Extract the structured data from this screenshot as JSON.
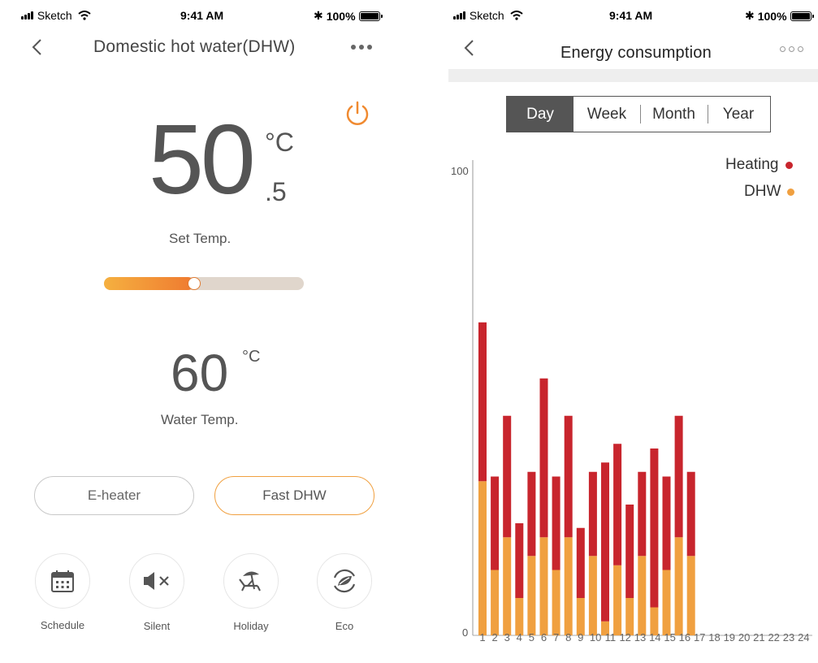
{
  "left_screen": {
    "status_bar": {
      "carrier": "Sketch",
      "time": "9:41 AM",
      "battery": "100%"
    },
    "nav": {
      "title": "Domestic hot water(DHW)"
    },
    "set_temp": {
      "integer": "50",
      "unit": "°C",
      "decimal": ".5",
      "label": "Set Temp."
    },
    "slider": {
      "level_fraction": 0.45,
      "gradient_start": "#f5b040",
      "gradient_end": "#ef7a30",
      "track_color": "#e0d6cc"
    },
    "water_temp": {
      "value": "60",
      "unit": "°C",
      "label": "Water Temp."
    },
    "buttons": {
      "eheater": "E-heater",
      "fast_dhw": "Fast DHW"
    },
    "modes": [
      {
        "label": "Schedule",
        "icon": "calendar-icon"
      },
      {
        "label": "Silent",
        "icon": "mute-speaker-icon"
      },
      {
        "label": "Holiday",
        "icon": "beach-chair-icon"
      },
      {
        "label": "Eco",
        "icon": "eco-leaf-icon"
      }
    ],
    "accent_color": "#f08a30"
  },
  "right_screen": {
    "status_bar": {
      "carrier": "Sketch",
      "time": "9:41 AM",
      "battery": "100%"
    },
    "nav": {
      "title": "Energy consumption"
    },
    "tabs": [
      "Day",
      "Week",
      "Month",
      "Year"
    ],
    "selected_tab": "Day",
    "chart_data": {
      "type": "bar",
      "stacked": true,
      "ylim": [
        0,
        100
      ],
      "ytick_labels": [
        "100",
        "0"
      ],
      "categories": [
        "1",
        "2",
        "3",
        "4",
        "5",
        "6",
        "7",
        "8",
        "9",
        "10",
        "11",
        "12",
        "13",
        "14",
        "15",
        "16",
        "17",
        "18",
        "19",
        "20",
        "21",
        "22",
        "23",
        "24"
      ],
      "series": [
        {
          "name": "DHW",
          "color": "#f0a040",
          "values": [
            33,
            14,
            21,
            8,
            17,
            21,
            14,
            21,
            8,
            17,
            3,
            15,
            8,
            17,
            6,
            14,
            21,
            17,
            0,
            0,
            0,
            0,
            0,
            0,
            0
          ]
        },
        {
          "name": "Heating",
          "color": "#c8252d",
          "values": [
            34,
            20,
            26,
            16,
            18,
            34,
            20,
            26,
            15,
            18,
            34,
            26,
            20,
            18,
            34,
            20,
            26,
            18,
            0,
            0,
            0,
            0,
            0,
            0,
            0
          ]
        }
      ],
      "legend_position": "top-right"
    }
  }
}
